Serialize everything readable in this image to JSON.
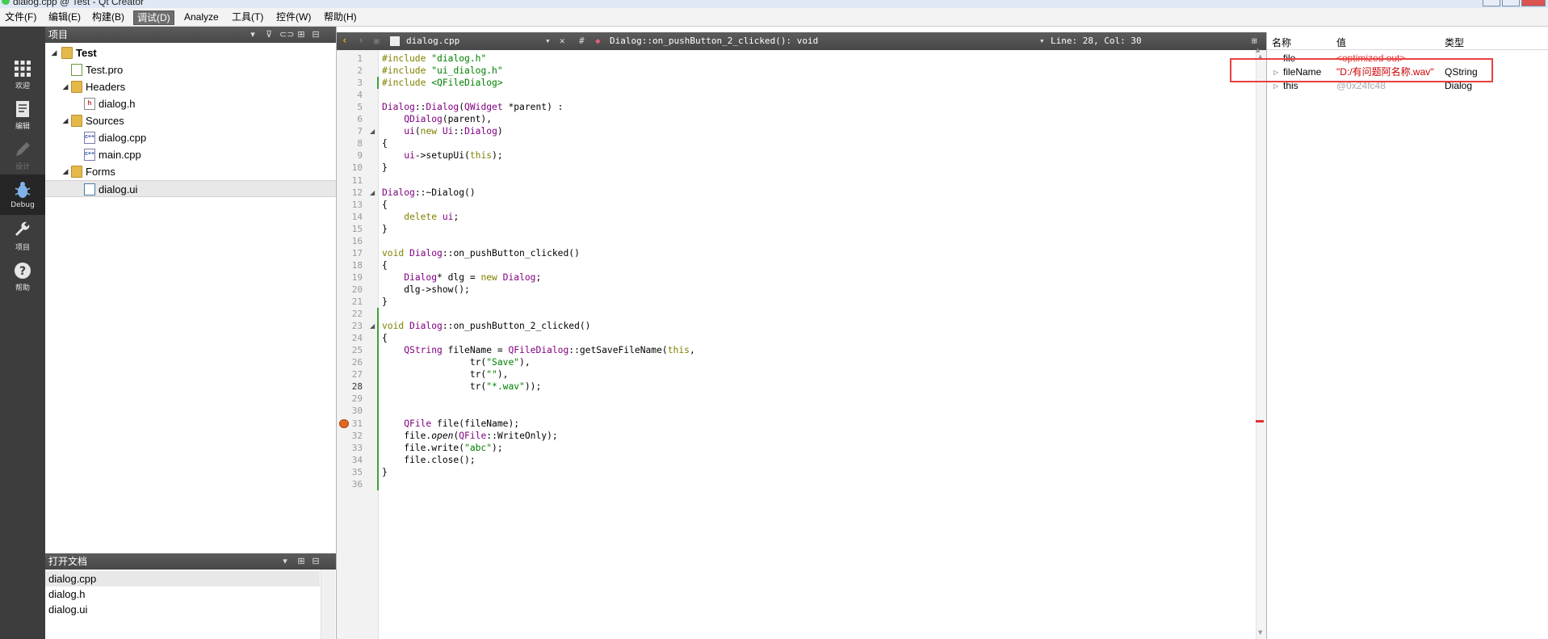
{
  "window": {
    "title": "dialog.cpp @ Test - Qt Creator"
  },
  "menu": [
    {
      "label": "文件(F)",
      "active": false
    },
    {
      "label": "编辑(E)",
      "active": false
    },
    {
      "label": "构建(B)",
      "active": false
    },
    {
      "label": "调试(D)",
      "active": true
    },
    {
      "label": "Analyze",
      "active": false
    },
    {
      "label": "工具(T)",
      "active": false
    },
    {
      "label": "控件(W)",
      "active": false
    },
    {
      "label": "帮助(H)",
      "active": false
    }
  ],
  "modes": [
    {
      "label": "欢迎",
      "icon": "grid-icon"
    },
    {
      "label": "编辑",
      "icon": "document-icon"
    },
    {
      "label": "设计",
      "icon": "pencil-icon"
    },
    {
      "label": "Debug",
      "icon": "bug-icon"
    },
    {
      "label": "项目",
      "icon": "wrench-icon"
    },
    {
      "label": "帮助",
      "icon": "question-icon"
    }
  ],
  "project_pane": {
    "title": "项目",
    "tree": [
      {
        "label": "Test",
        "kind": "project",
        "bold": true
      },
      {
        "label": "Test.pro",
        "kind": "pro"
      },
      {
        "label": "Headers",
        "kind": "folder"
      },
      {
        "label": "dialog.h",
        "kind": "h"
      },
      {
        "label": "Sources",
        "kind": "folder"
      },
      {
        "label": "dialog.cpp",
        "kind": "cpp"
      },
      {
        "label": "main.cpp",
        "kind": "cpp"
      },
      {
        "label": "Forms",
        "kind": "folder"
      },
      {
        "label": "dialog.ui",
        "kind": "ui",
        "selected": true
      }
    ]
  },
  "open_docs": {
    "title": "打开文档",
    "items": [
      "dialog.cpp",
      "dialog.h",
      "dialog.ui"
    ],
    "selected": 0
  },
  "editor_toolbar": {
    "file": "dialog.cpp",
    "hash": "#",
    "function": "Dialog::on_pushButton_2_clicked(): void",
    "position": "Line: 28, Col: 30"
  },
  "editor": {
    "current_line": 28,
    "breakpoint_line": 31,
    "lines": [
      "#include \"dialog.h\"",
      "#include \"ui_dialog.h\"",
      "#include <QFileDialog>",
      "",
      "Dialog::Dialog(QWidget *parent) :",
      "    QDialog(parent),",
      "    ui(new Ui::Dialog)",
      "{",
      "    ui->setupUi(this);",
      "}",
      "",
      "Dialog::~Dialog()",
      "{",
      "    delete ui;",
      "}",
      "",
      "void Dialog::on_pushButton_clicked()",
      "{",
      "    Dialog* dlg = new Dialog;",
      "    dlg->show();",
      "}",
      "",
      "void Dialog::on_pushButton_2_clicked()",
      "{",
      "    QString fileName = QFileDialog::getSaveFileName(this,",
      "                tr(\"Save\"),",
      "                tr(\"\"),",
      "                tr(\"*.wav\"));",
      "",
      "",
      "    QFile file(fileName);",
      "    file.open(QFile::WriteOnly);",
      "    file.write(\"abc\");",
      "    file.close();",
      "}",
      ""
    ]
  },
  "locals": {
    "headers": {
      "name": "名称",
      "value": "值",
      "type": "类型"
    },
    "rows": [
      {
        "name": "file",
        "value": "<optimized out>",
        "type": "",
        "expandable": false,
        "value_color": "#e03030"
      },
      {
        "name": "fileName",
        "value": "\"D:/有问题阿名称.wav\"",
        "type": "QString",
        "expandable": true,
        "value_color": "#cc0000"
      },
      {
        "name": "this",
        "value": "@0x24fc48",
        "type": "Dialog",
        "expandable": true,
        "value_color": "#a8a8a8"
      }
    ]
  },
  "colors": {
    "modebar": "#3d3d3d",
    "highlight_box": "#e84040",
    "keyword": "#808000",
    "string": "#008000",
    "type": "#800080"
  }
}
